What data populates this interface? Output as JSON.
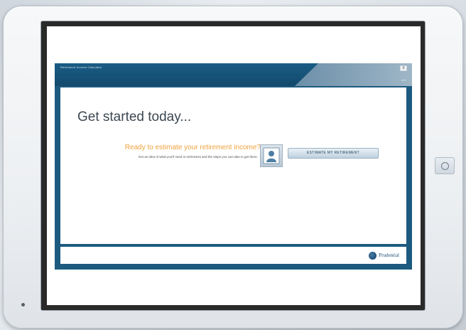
{
  "window": {
    "title": "Retirement Income Calculator",
    "close_label": "X",
    "font_size_label": "A A"
  },
  "main": {
    "heading": "Get started today...",
    "prompt": "Ready to estimate your retirement income?",
    "description": "Get an idea of what you'll need in retirement and the steps you can take to get there.",
    "estimate_button_label": "ESTIMATE MY RETIREMENT"
  },
  "footer": {
    "brand_name": "Prudential"
  },
  "icons": {
    "avatar": "person-icon",
    "brand": "prudential-logo-icon",
    "home": "home-button-icon",
    "camera": "camera-icon"
  }
}
